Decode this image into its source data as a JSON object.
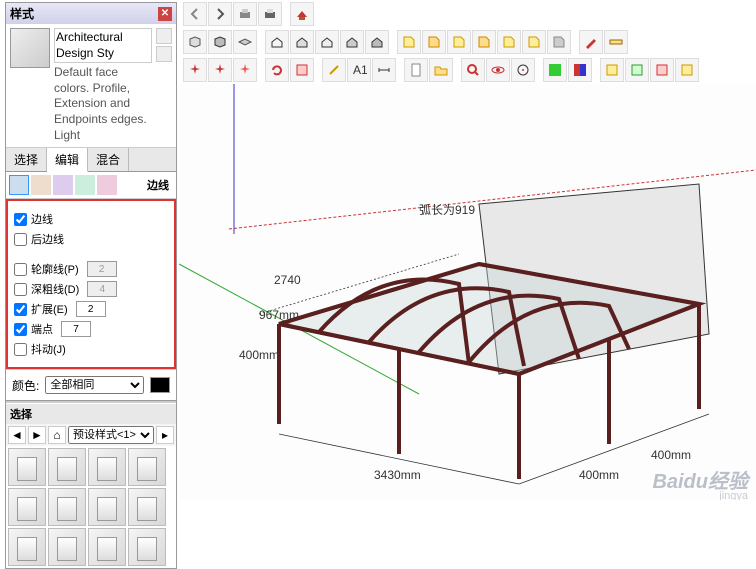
{
  "panel": {
    "title": "样式",
    "style_name": "Architectural Design Sty",
    "style_desc": "Default face colors. Profile, Extension and Endpoints edges. Light",
    "tabs": {
      "select": "选择",
      "edit": "编辑",
      "mix": "混合"
    },
    "subtab_label": "边线",
    "checks": {
      "edges": "边线",
      "back_edges": "后边线",
      "profiles": "轮廓线(P)",
      "depth_cue": "深粗线(D)",
      "extension": "扩展(E)",
      "endpoints": "端点",
      "jitter": "抖动(J)"
    },
    "vals": {
      "profiles": "2",
      "depth_cue": "4",
      "extension": "2",
      "endpoints": "7"
    },
    "color_label": "颜色:",
    "color_mode": "全部相同"
  },
  "browser": {
    "title": "选择",
    "dropdown": "预设样式<1>"
  },
  "model": {
    "arc_label": "弧长为919",
    "dims": {
      "a": "2740",
      "b": "967mm",
      "c": "400mm",
      "d": "3430mm",
      "e": "400mm",
      "f": "400mm"
    }
  },
  "watermark": {
    "main": "Baidu经验",
    "sub": "jingya"
  }
}
